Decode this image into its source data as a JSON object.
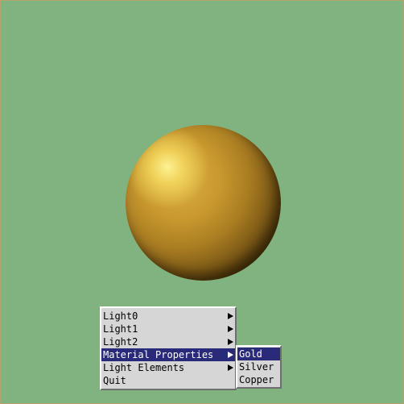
{
  "scene": {
    "background_color": "#80b380",
    "sphere_material": "gold"
  },
  "main_menu": {
    "items": [
      {
        "label": "Light0",
        "has_submenu": true,
        "selected": false
      },
      {
        "label": "Light1",
        "has_submenu": true,
        "selected": false
      },
      {
        "label": "Light2",
        "has_submenu": true,
        "selected": false
      },
      {
        "label": "Material Properties",
        "has_submenu": true,
        "selected": true
      },
      {
        "label": "Light Elements",
        "has_submenu": true,
        "selected": false
      },
      {
        "label": "Quit",
        "has_submenu": false,
        "selected": false
      }
    ]
  },
  "submenu": {
    "items": [
      {
        "label": "Gold",
        "selected": true
      },
      {
        "label": "Silver",
        "selected": false
      },
      {
        "label": "Copper",
        "selected": false
      }
    ]
  },
  "colors": {
    "menu_bg": "#d6d6d6",
    "highlight_bg": "#2a2a7a",
    "highlight_text": "#ffffff"
  }
}
